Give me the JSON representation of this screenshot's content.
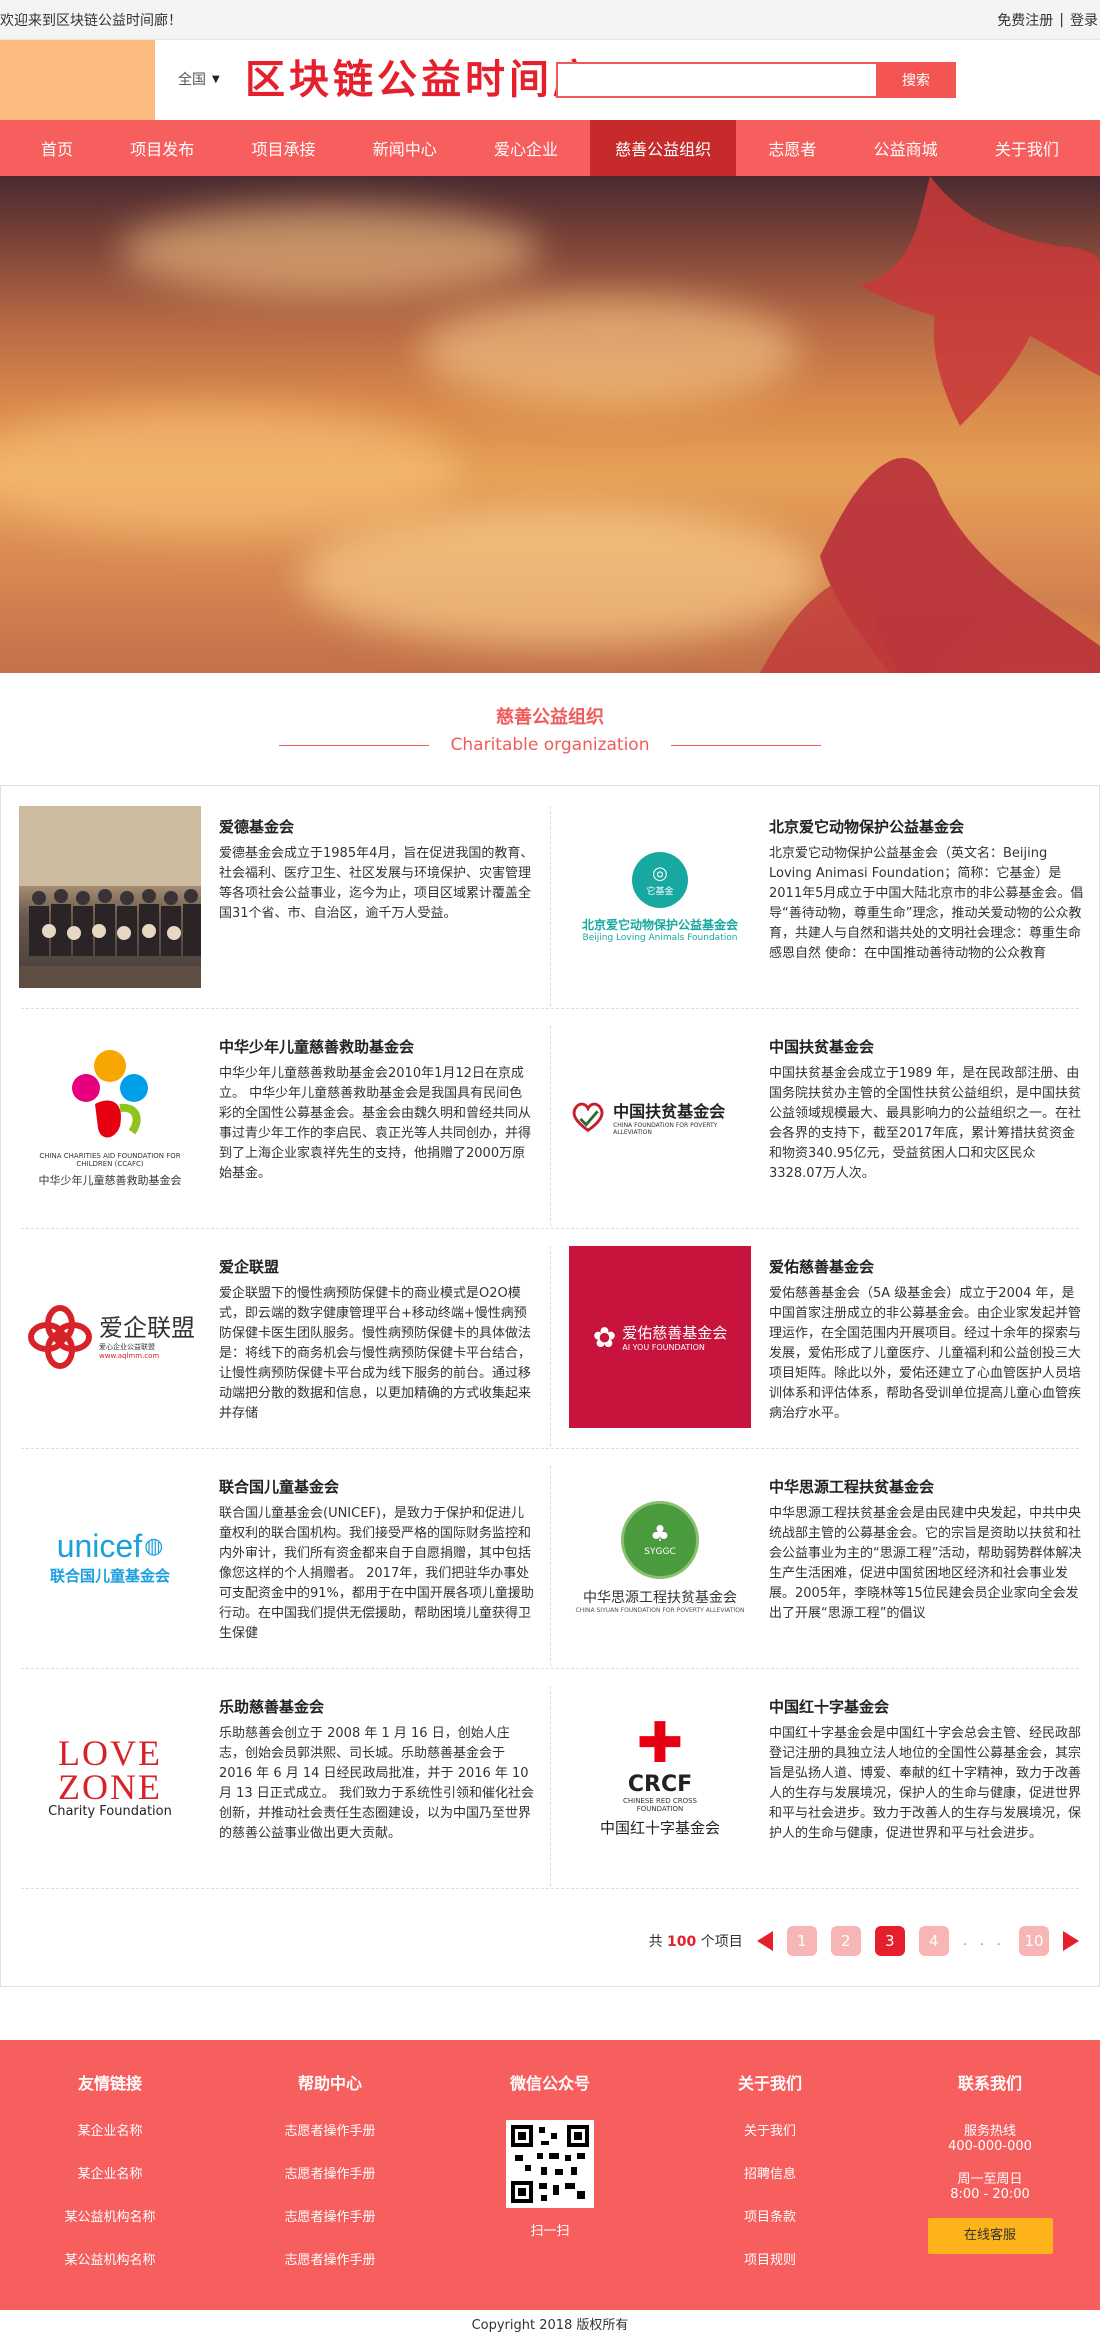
{
  "topbar": {
    "welcome": "欢迎来到区块链公益时间廊！",
    "register": "免费注册",
    "divider": "|",
    "login": "登录"
  },
  "header": {
    "region": "全国",
    "brand": "区块链公益时间廊",
    "search_placeholder": "",
    "search_button": "搜索"
  },
  "nav": {
    "items": [
      "首页",
      "项目发布",
      "项目承接",
      "新闻中心",
      "爱心企业",
      "慈善公益组织",
      "志愿者",
      "公益商城",
      "关于我们"
    ],
    "active_index": 5
  },
  "section": {
    "title_cn": "慈善公益组织",
    "title_en": "Charitable organization"
  },
  "orgs": [
    {
      "name": "爱德基金会",
      "desc": "爱德基金会成立于1985年4月，旨在促进我国的教育、社会福利、医疗卫生、社区发展与环境保护、灾害管理等各项社会公益事业，迄今为止，项目区域累计覆盖全国31个省、市、自治区，逾千万人受益。"
    },
    {
      "name": "北京爱它动物保护公益基金会",
      "desc": "北京爱它动物保护公益基金会（英文名：Beijing Loving Animasi Foundation；简称：它基金）是2011年5月成立于中国大陆北京市的非公募基金会。倡导“善待动物，尊重生命”理念，推动关爱动物的公众教育，共建人与自然和谐共处的文明社会理念：尊重生命 感恩自然 使命：在中国推动善待动物的公众教育",
      "logo_cn": "北京爱它动物保护公益基金会",
      "logo_en": "Beijing Loving Animals Foundation",
      "logo_mark": "它基金"
    },
    {
      "name": "中华少年儿童慈善救助基金会",
      "desc": "中华少年儿童慈善救助基金会2010年1月12日在京成立。 中华少年儿童慈善救助基金会是我国具有民间色彩的全国性公募基金会。基金会由魏久明和曾经共同从事过青少年工作的李启民、袁正光等人共同创办，并得到了上海企业家袁祥先生的支持，他捐赠了2000万原始基金。",
      "logo_en": "CHINA CHARITIES AID FOUNDATION FOR CHILDREN (CCAFC)",
      "logo_cn": "中华少年儿童慈善救助基金会"
    },
    {
      "name": "中国扶贫基金会",
      "desc": "中国扶贫基金会成立于1989 年，是在民政部注册、由国务院扶贫办主管的全国性扶贫公益组织，是中国扶贫公益领域规模最大、最具影响力的公益组织之一。在社会各界的支持下，截至2017年底，累计筹措扶贫资金和物资340.95亿元，受益贫困人口和灾区民众3328.07万人次。",
      "logo_cn": "中国扶贫基金会",
      "logo_en": "CHINA FOUNDATION FOR POVERTY ALLEVIATION"
    },
    {
      "name": "爱企联盟",
      "desc": "爱企联盟下的慢性病预防保健卡的商业模式是O2O模式，即云端的数字健康管理平台+移动终端+慢性病预防保健卡医生团队服务。慢性病预防保健卡的具体做法是：将线下的商务机会与慢性病预防保健卡平台结合，让慢性病预防保健卡平台成为线下服务的前台。通过移动端把分散的数据和信息，以更加精确的方式收集起来并存储",
      "logo_cn": "爱企联盟",
      "logo_sub": "爱心企业公益联盟",
      "logo_url": "www.aqlmm.com"
    },
    {
      "name": "爱佑慈善基金会",
      "desc": " 爱佑慈善基金会（5A 级基金会）成立于2004 年，是中国首家注册成立的非公募基金会。由企业家发起并管理运作，在全国范围内开展项目。经过十余年的探索与发展，爱佑形成了儿童医疗、儿童福利和公益创投三大项目矩阵。除此以外，爱佑还建立了心血管医护人员培训体系和评估体系，帮助各受训单位提高儿童心血管疾病治疗水平。",
      "logo_cn": "爱佑慈善基金会",
      "logo_en": "AI YOU FOUNDATION"
    },
    {
      "name": "联合国儿童基金会",
      "desc": "联合国儿童基金会(UNICEF)，是致力于保护和促进儿童权利的联合国机构。我们接受严格的国际财务监控和内外审计，我们所有资金都来自于自愿捐赠，其中包括像您这样的个人捐赠者。 2017年，我们把驻华办事处可支配资金中的91%，都用于在中国开展各项儿童援助行动。在中国我们提供无偿援助，帮助困境儿童获得卫生保健",
      "logo_en": "unicef",
      "logo_cn": "联合国儿童基金会"
    },
    {
      "name": "中华思源工程扶贫基金会",
      "desc": "中华思源工程扶贫基金会是由民建中央发起，中共中央统战部主管的公募基金会。它的宗旨是资助以扶贫和社会公益事业为主的“思源工程”活动，帮助弱势群体解决生产生活困难，促进中国贫困地区经济和社会事业发展。2005年，李晓林等15位民建会员企业家向全会发出了开展“思源工程”的倡议",
      "logo_cn": "中华思源工程扶贫基金会",
      "logo_en": "CHINA SIYUAN FOUNDATION FOR POVERTY ALLEVIATION",
      "logo_badge": "SYGGC"
    },
    {
      "name": "乐助慈善基金会",
      "desc": "乐助慈善会创立于 2008 年 1 月 16 日，创始人庄志，创始会员郭洪熙、司长城。乐助慈善基金会于 2016 年 6 月 14 日经民政局批准，并于 2016 年 10 月 13 日正式成立。 我们致力于系统性引领和催化社会创新，并推动社会责任生态圈建设，以为中国乃至世界的慈善公益事业做出更大贡献。",
      "logo_top": "LOVE",
      "logo_mid": "ZONE",
      "logo_en": "Charity Foundation"
    },
    {
      "name": "中国红十字基金会",
      "desc": "中国红十字基金会是中国红十字会总会主管、经民政部登记注册的具独立法人地位的全国性公募基金会，其宗旨是弘扬人道、博爱、奉献的红十字精神，致力于改善人的生存与发展境况，保护人的生命与健康，促进世界和平与社会进步。致力于改善人的生存与发展境况，保护人的生命与健康，促进世界和平与社会进步。",
      "logo_en": "CRCF",
      "logo_sub": "CHINESE RED CROSS FOUNDATION",
      "logo_cn": "中国红十字基金会"
    }
  ],
  "pager": {
    "total_prefix": "共",
    "total": "100",
    "total_suffix": "个项目",
    "pages": [
      "1",
      "2",
      "3",
      "4",
      "10"
    ],
    "current": "3",
    "dots": ". . ."
  },
  "footer": {
    "cols": [
      {
        "title": "友情链接",
        "links": [
          "某企业名称",
          "某企业名称",
          "某公益机构名称",
          "某公益机构名称"
        ]
      },
      {
        "title": "帮助中心",
        "links": [
          "志愿者操作手册",
          "志愿者操作手册",
          "志愿者操作手册",
          "志愿者操作手册"
        ]
      },
      {
        "title": "微信公众号",
        "scan": "扫一扫"
      },
      {
        "title": "关于我们",
        "links": [
          "关于我们",
          "招聘信息",
          "项目条款",
          "项目规则"
        ]
      },
      {
        "title": "联系我们",
        "hotline_label": "服务热线",
        "hotline": "400-000-000",
        "hours_label": "周一至周日",
        "hours": "8:00 - 20:00",
        "service": "在线客服"
      }
    ],
    "copyright": "Copyright 2018 版权所有"
  },
  "colors": {
    "primary": "#f75f5f",
    "accent": "#e5202c",
    "nav_active": "#c72a2a",
    "service_button": "#ffb31b"
  }
}
